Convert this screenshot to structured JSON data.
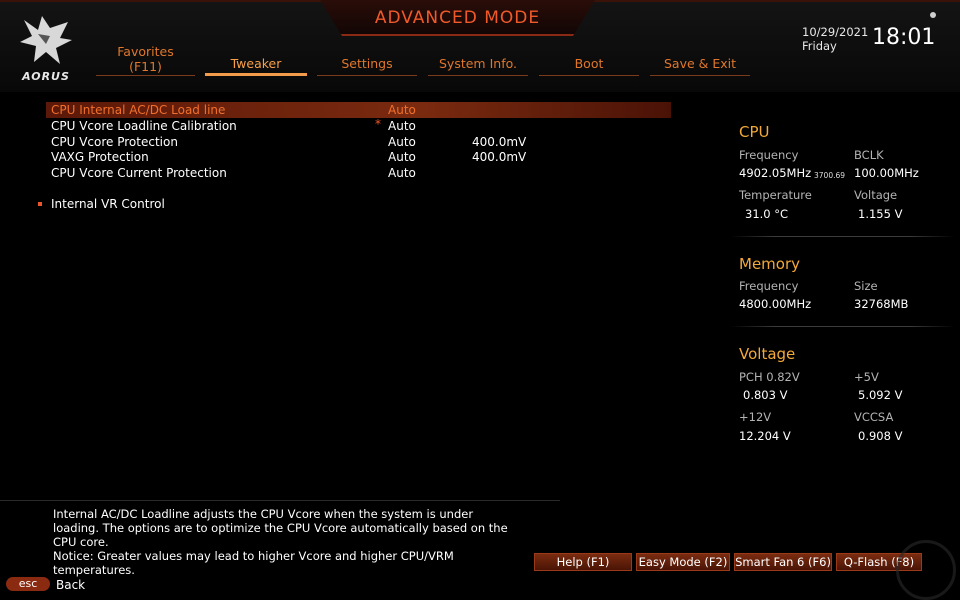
{
  "header": {
    "mode_title": "ADVANCED MODE",
    "logo_text": "AORUS",
    "date": "10/29/2021",
    "day": "Friday",
    "time": "18:01"
  },
  "tabs": [
    {
      "label": "Favorites\n(F11)",
      "active": false
    },
    {
      "label": "Tweaker",
      "active": true
    },
    {
      "label": "Settings",
      "active": false
    },
    {
      "label": "System Info.",
      "active": false
    },
    {
      "label": "Boot",
      "active": false
    },
    {
      "label": "Save & Exit",
      "active": false
    }
  ],
  "settings": [
    {
      "label": "CPU Internal AC/DC Load line",
      "value": "Auto",
      "extra": ""
    },
    {
      "label": "CPU Vcore Loadline Calibration",
      "value": "Auto",
      "extra": ""
    },
    {
      "label": "CPU Vcore Protection",
      "value": "Auto",
      "extra": "400.0mV"
    },
    {
      "label": "VAXG Protection",
      "value": "Auto",
      "extra": "400.0mV"
    },
    {
      "label": "CPU Vcore Current Protection",
      "value": "Auto",
      "extra": ""
    }
  ],
  "modified_marker": "*",
  "submenu": {
    "label": "Internal VR Control"
  },
  "cpu": {
    "title": "CPU",
    "frequency_label": "Frequency",
    "frequency": "4902.05MHz",
    "frequency_base": "3700.69",
    "bclk_label": "BCLK",
    "bclk": "100.00MHz",
    "temperature_label": "Temperature",
    "temperature": "31.0 °C",
    "voltage_label": "Voltage",
    "voltage": "1.155 V"
  },
  "memory": {
    "title": "Memory",
    "frequency_label": "Frequency",
    "frequency": "4800.00MHz",
    "size_label": "Size",
    "size": "32768MB"
  },
  "voltage": {
    "title": "Voltage",
    "pch_label": "PCH 0.82V",
    "pch": "0.803 V",
    "v5_label": "+5V",
    "v5": "5.092 V",
    "v12_label": "+12V",
    "v12": "12.204 V",
    "vccsa_label": "VCCSA",
    "vccsa": "0.908 V"
  },
  "help": {
    "line1": "Internal AC/DC Loadline adjusts the CPU Vcore when the system is under loading. The options are to optimize the CPU Vcore automatically based on the CPU core.",
    "line2": "Notice: Greater values may lead to higher Vcore and higher CPU/VRM temperatures."
  },
  "buttons": {
    "help": "Help (F1)",
    "easy_mode": "Easy Mode (F2)",
    "smart_fan": "Smart Fan 6 (F6)",
    "qflash": "Q-Flash (F8)"
  },
  "esc": {
    "key": "esc",
    "label": "Back"
  },
  "colors": {
    "accent": "#f05a2a",
    "panel_title": "#f2a93a",
    "selected_row": "#7a2a0f"
  }
}
